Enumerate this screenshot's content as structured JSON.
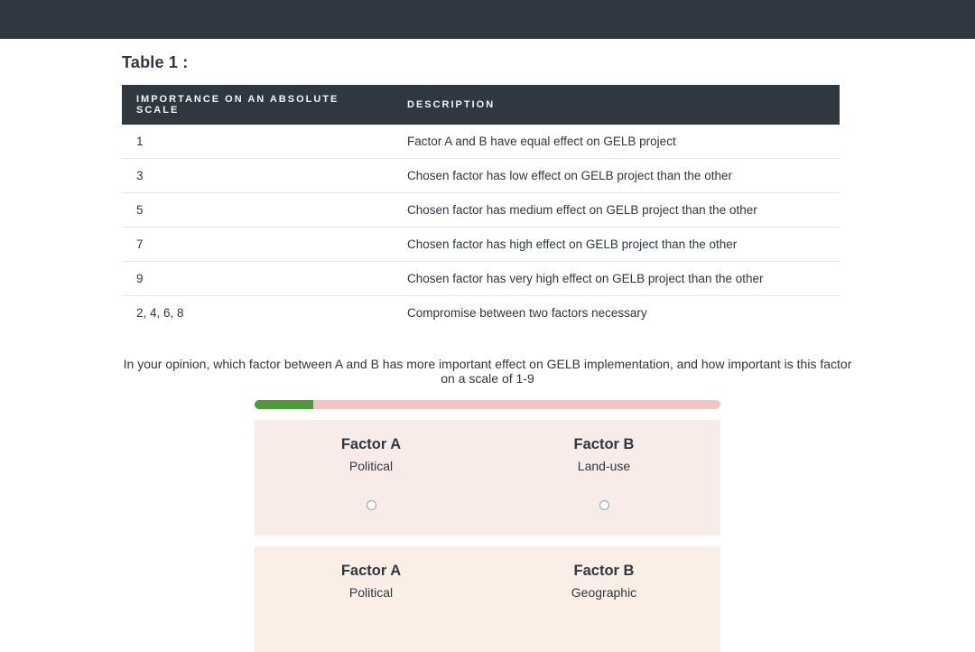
{
  "page": {
    "table_title": "Table 1 :",
    "question": "In your opinion, which factor between A and B has more important effect on GELB implementation, and how important is this factor on a scale of 1-9"
  },
  "table": {
    "head": {
      "col_importance": "Importance on an absolute scale",
      "col_description": "Description"
    },
    "rows": [
      {
        "level": "1",
        "desc": "Factor A and B have equal effect on GELB project"
      },
      {
        "level": "3",
        "desc": "Chosen factor has low effect on GELB project than the other"
      },
      {
        "level": "5",
        "desc": "Chosen factor has medium effect on GELB project than the other"
      },
      {
        "level": "7",
        "desc": "Chosen factor has high effect on GELB project than the other"
      },
      {
        "level": "9",
        "desc": "Chosen factor has very high effect on GELB project than the other"
      },
      {
        "level": "2, 4, 6, 8",
        "desc": "Compromise between two factors necessary"
      }
    ]
  },
  "progress": {
    "percent": 12.5
  },
  "pairs": [
    {
      "a_title": "Factor A",
      "a_sub": "Political",
      "b_title": "Factor B",
      "b_sub": "Land-use"
    },
    {
      "a_title": "Factor A",
      "a_sub": "Political",
      "b_title": "Factor B",
      "b_sub": "Geographic"
    }
  ]
}
